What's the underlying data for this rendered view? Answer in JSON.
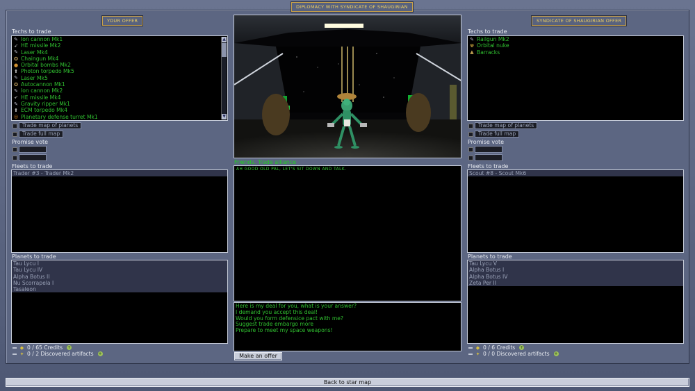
{
  "window_title": "Diplomacy with Syndicate of Shaugirian",
  "left": {
    "tag": "Your offer",
    "techs_label": "Techs to trade",
    "techs": [
      {
        "icon": "gun-icon",
        "label": "Ion cannon Mk1"
      },
      {
        "icon": "missile-icon",
        "label": "HE missile Mk2"
      },
      {
        "icon": "gun-icon",
        "label": "Laser Mk4"
      },
      {
        "icon": "chaingun-icon",
        "label": "Chaingun Mk4"
      },
      {
        "icon": "bomb-icon",
        "label": "Orbital bombs Mk2"
      },
      {
        "icon": "torpedo-icon",
        "label": "Photon torpedo Mk5"
      },
      {
        "icon": "gun-icon",
        "label": "Laser Mk5"
      },
      {
        "icon": "chaingun-icon",
        "label": "Autocannon Mk1"
      },
      {
        "icon": "gun-icon",
        "label": "Ion cannon Mk2"
      },
      {
        "icon": "missile-icon",
        "label": "HE missile Mk4"
      },
      {
        "icon": "gun-icon",
        "label": "Gravity ripper Mk1"
      },
      {
        "icon": "torpedo-icon",
        "label": "ECM torpedo Mk4"
      },
      {
        "icon": "turret-icon",
        "label": "Planetary defense turret Mk1"
      }
    ],
    "trade_map_planets": "Trade map of planets",
    "trade_full_map": "Trade full map",
    "promise_vote_label": "Promise vote",
    "fleets_label": "Fleets to trade",
    "fleets": [
      "Trader #3 - Trader Mk2"
    ],
    "planets_label": "Planets to trade",
    "planets": [
      "Tau Lycu I",
      "Tau Lycu IV",
      "Alpha Botus II",
      "Nu Scorrapela I",
      "Tasaleon"
    ],
    "credits": "0 / 65 Credits",
    "artifacts": "0 / 2 Discovered artifacts"
  },
  "right": {
    "tag": "Syndicate of Shaugirian offer",
    "techs_label": "Techs to trade",
    "techs": [
      {
        "icon": "gun-icon",
        "label": "Railgun Mk2"
      },
      {
        "icon": "nuke-icon",
        "label": "Orbital nuke"
      },
      {
        "icon": "barracks-icon",
        "label": "Barracks"
      }
    ],
    "trade_map_planets": "Trade map of planets",
    "trade_full_map": "Trade full map",
    "promise_vote_label": "Promise vote",
    "fleets_label": "Fleets to trade",
    "fleets": [
      "Scout #8 - Scout Mk6"
    ],
    "planets_label": "Planets to trade",
    "planets": [
      "Tau Lycu V",
      "Alpha Botus I",
      "Alpha Botus IV",
      "Zeta Per II"
    ],
    "credits": "0 / 6 Credits",
    "artifacts": "0 / 0 Discovered artifacts"
  },
  "center": {
    "relation": "Friends. Trade alliance",
    "message": "Ah good old pal, let's sit down and talk.",
    "options": [
      "Here is my deal for you, what is your answer?",
      "I demand you accept this deal!",
      "Would you form defensice pact with me?",
      "Suggest trade embargo more",
      "Prepare to meet my space weapons!"
    ],
    "make_offer": "Make an offer"
  },
  "back_button": "Back to star map",
  "colors": {
    "accent": "#f0d060",
    "list_text": "#30c030",
    "relation": "#20d020"
  }
}
